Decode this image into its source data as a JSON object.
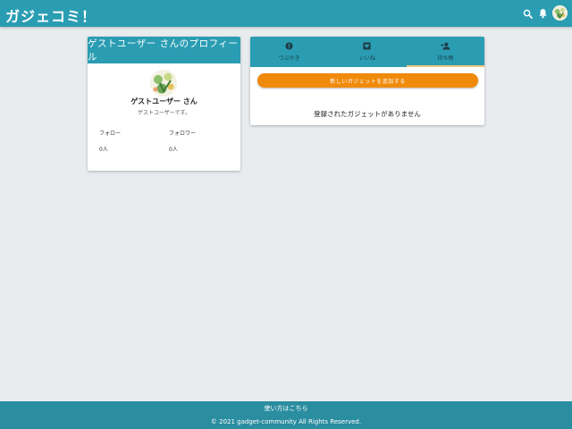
{
  "app": {
    "title": "ガジェコミ！"
  },
  "header": {
    "icons": [
      "search-icon",
      "bell-icon",
      "user-avatar"
    ]
  },
  "profile": {
    "heading": "ゲストユーザー さんのプロフィール",
    "name": "ゲストユーザー さん",
    "bio": "ゲストユーザーです。",
    "follow_label": "フォロー",
    "follow_count": "0人",
    "follower_label": "フォロワー",
    "follower_count": "0人"
  },
  "tabs": [
    {
      "label": "つぶやき",
      "icon": "comment-icon"
    },
    {
      "label": "いいね",
      "icon": "heart-icon"
    },
    {
      "label": "持ち物",
      "icon": "user-add-icon",
      "active": true
    }
  ],
  "gadgets": {
    "add_button": "新しいガジェットを追加する",
    "empty_message": "登録されたガジェットがありません"
  },
  "footer": {
    "link": "使い方はこちら",
    "copyright": "© 2021 gadget-community All Rights Reserved."
  },
  "colors": {
    "primary": "#2a9db3",
    "accent": "#f08a0a",
    "footer": "#2a8da0",
    "background": "#e9ecef"
  }
}
